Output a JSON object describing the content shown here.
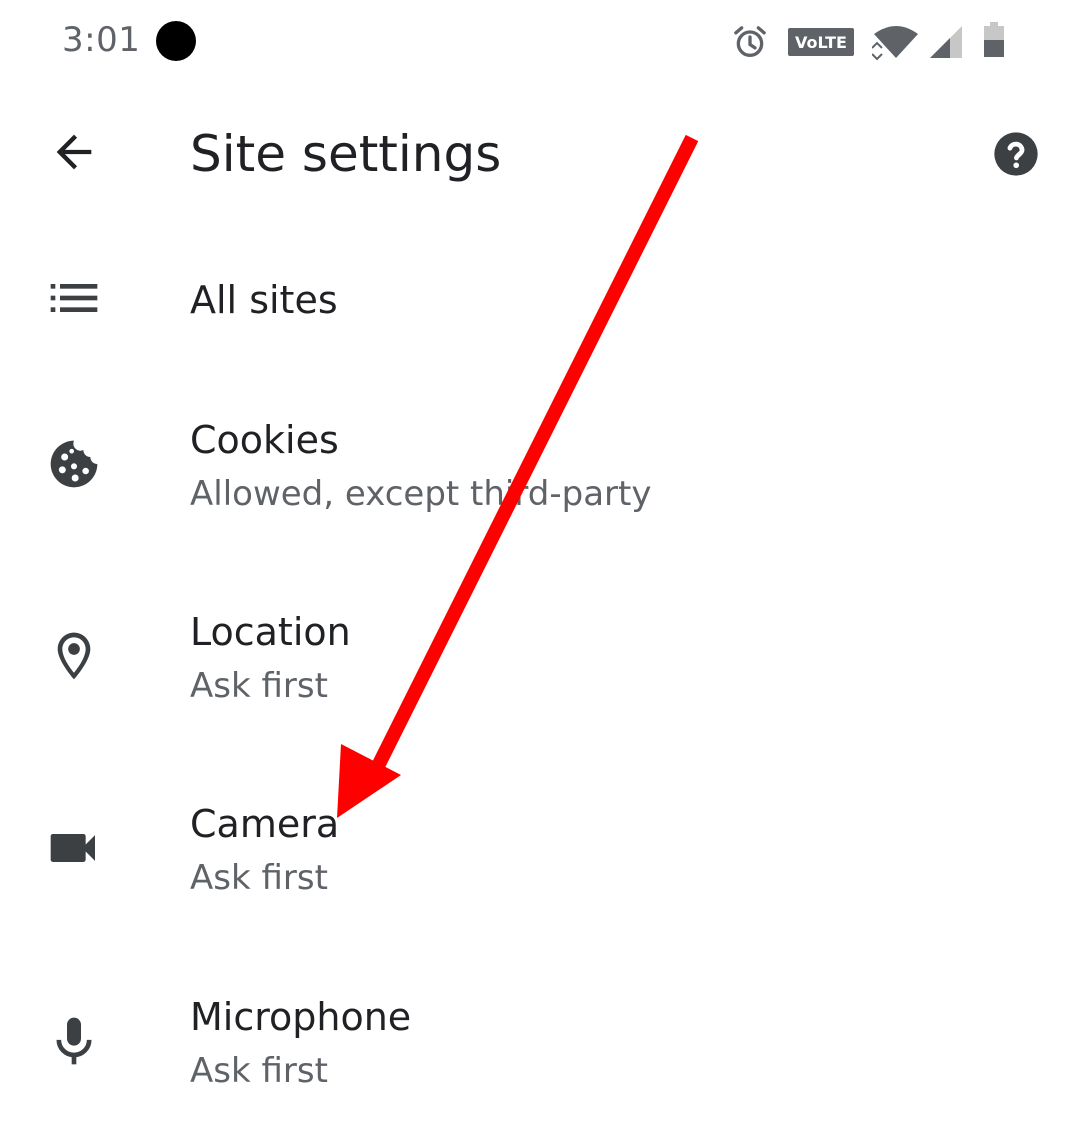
{
  "status_bar": {
    "time": "3:01",
    "volte_label": "VoLTE",
    "icons": [
      "alarm-icon",
      "volte-icon",
      "wifi-icon",
      "cell-signal-icon",
      "battery-icon"
    ]
  },
  "app_bar": {
    "title": "Site settings",
    "back_icon": "arrow-back-icon",
    "help_icon": "help-icon"
  },
  "items": [
    {
      "icon": "list-icon",
      "title": "All sites",
      "subtitle": ""
    },
    {
      "icon": "cookie-icon",
      "title": "Cookies",
      "subtitle": "Allowed, except third-party"
    },
    {
      "icon": "location-pin-icon",
      "title": "Location",
      "subtitle": "Ask first"
    },
    {
      "icon": "videocam-icon",
      "title": "Camera",
      "subtitle": "Ask first"
    },
    {
      "icon": "mic-icon",
      "title": "Microphone",
      "subtitle": "Ask first"
    }
  ],
  "colors": {
    "text_primary": "#202124",
    "text_secondary": "#5f6368",
    "icon": "#3c4043",
    "annotation_arrow": "#ff0000"
  }
}
